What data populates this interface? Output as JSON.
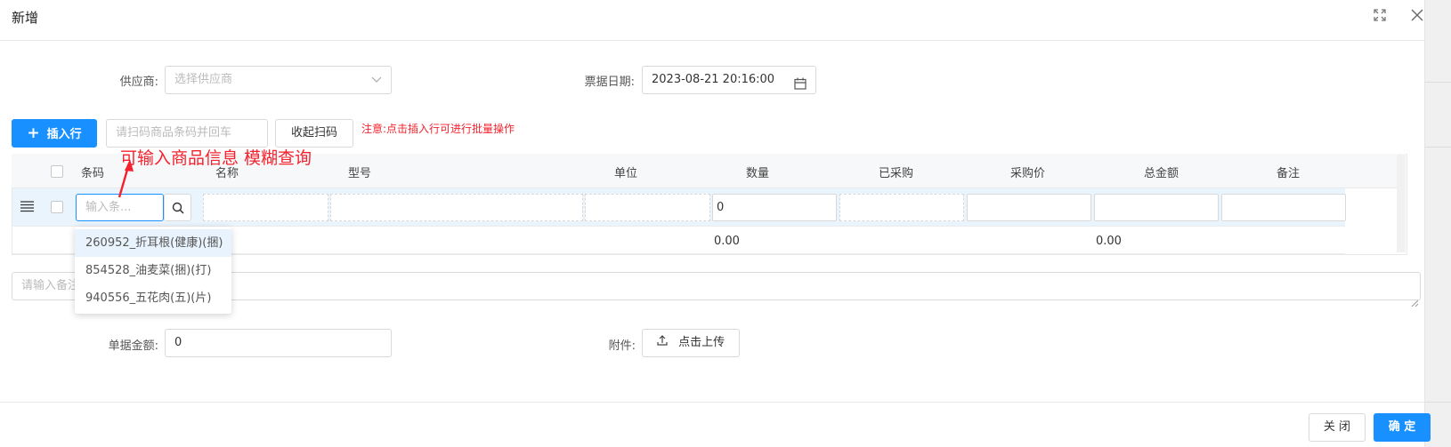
{
  "dialog": {
    "title": "新增"
  },
  "form": {
    "supplier_label": "供应商:",
    "supplier_placeholder": "选择供应商",
    "date_label": "票据日期:",
    "date_value": "2023-08-21 20:16:00",
    "amount_label": "单据金额:",
    "amount_value": "0",
    "attachment_label": "附件:",
    "upload_label": "点击上传",
    "remark_placeholder": "请输入备注"
  },
  "toolbar": {
    "insert_row_label": "插入行",
    "scan_placeholder": "请扫码商品条码并回车",
    "collapse_scan_label": "收起扫码",
    "notice": "注意:点击插入行可进行批量操作"
  },
  "annotation": "可输入商品信息 模糊查询",
  "table": {
    "columns": [
      "条码",
      "名称",
      "型号",
      "单位",
      "数量",
      "已采购",
      "采购价",
      "总金额",
      "备注"
    ],
    "row": {
      "barcode_placeholder": "输入条...",
      "quantity": "0"
    },
    "totals": {
      "quantity": "0.00",
      "amount": "0.00"
    }
  },
  "dropdown": {
    "items": [
      "260952_折耳根(健康)(捆)",
      "854528_油麦菜(捆)(打)",
      "940556_五花肉(五)(片)"
    ]
  },
  "footer": {
    "close_label": "关 闭",
    "confirm_label": "确 定"
  },
  "icons": [
    "fullscreen-icon",
    "close-icon",
    "chevron-down-icon",
    "calendar-icon",
    "plus-icon",
    "search-icon",
    "drag-handle-icon",
    "upload-icon"
  ],
  "colors": {
    "primary": "#1890ff",
    "danger": "#f5222d",
    "row_highlight": "#eaf4fd"
  }
}
